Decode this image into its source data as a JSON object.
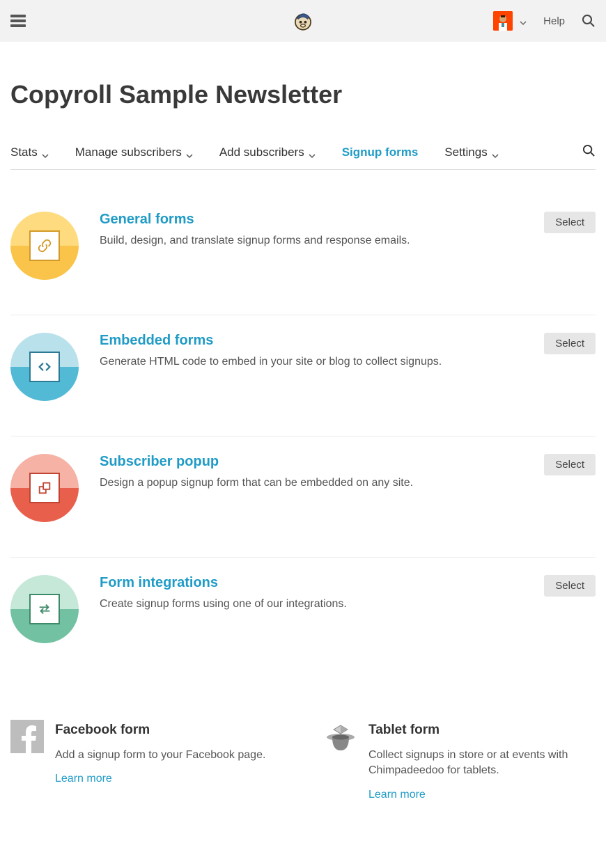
{
  "header": {
    "help_label": "Help"
  },
  "page": {
    "title": "Copyroll Sample Newsletter"
  },
  "tabs": {
    "stats": "Stats",
    "manage": "Manage subscribers",
    "add": "Add subscribers",
    "signup": "Signup forms",
    "settings": "Settings"
  },
  "select_label": "Select",
  "forms": [
    {
      "title": "General forms",
      "desc": "Build, design, and translate signup forms and response emails."
    },
    {
      "title": "Embedded forms",
      "desc": "Generate HTML code to embed in your site or blog to collect signups."
    },
    {
      "title": "Subscriber popup",
      "desc": "Design a popup signup form that can be embedded on any site."
    },
    {
      "title": "Form integrations",
      "desc": "Create signup forms using one of our integrations."
    }
  ],
  "extras": {
    "facebook": {
      "title": "Facebook form",
      "desc": "Add a signup form to your Facebook page.",
      "link": "Learn more"
    },
    "tablet": {
      "title": "Tablet form",
      "desc": "Collect signups in store or at events with Chimpadeedoo for tablets.",
      "link": "Learn more"
    }
  }
}
